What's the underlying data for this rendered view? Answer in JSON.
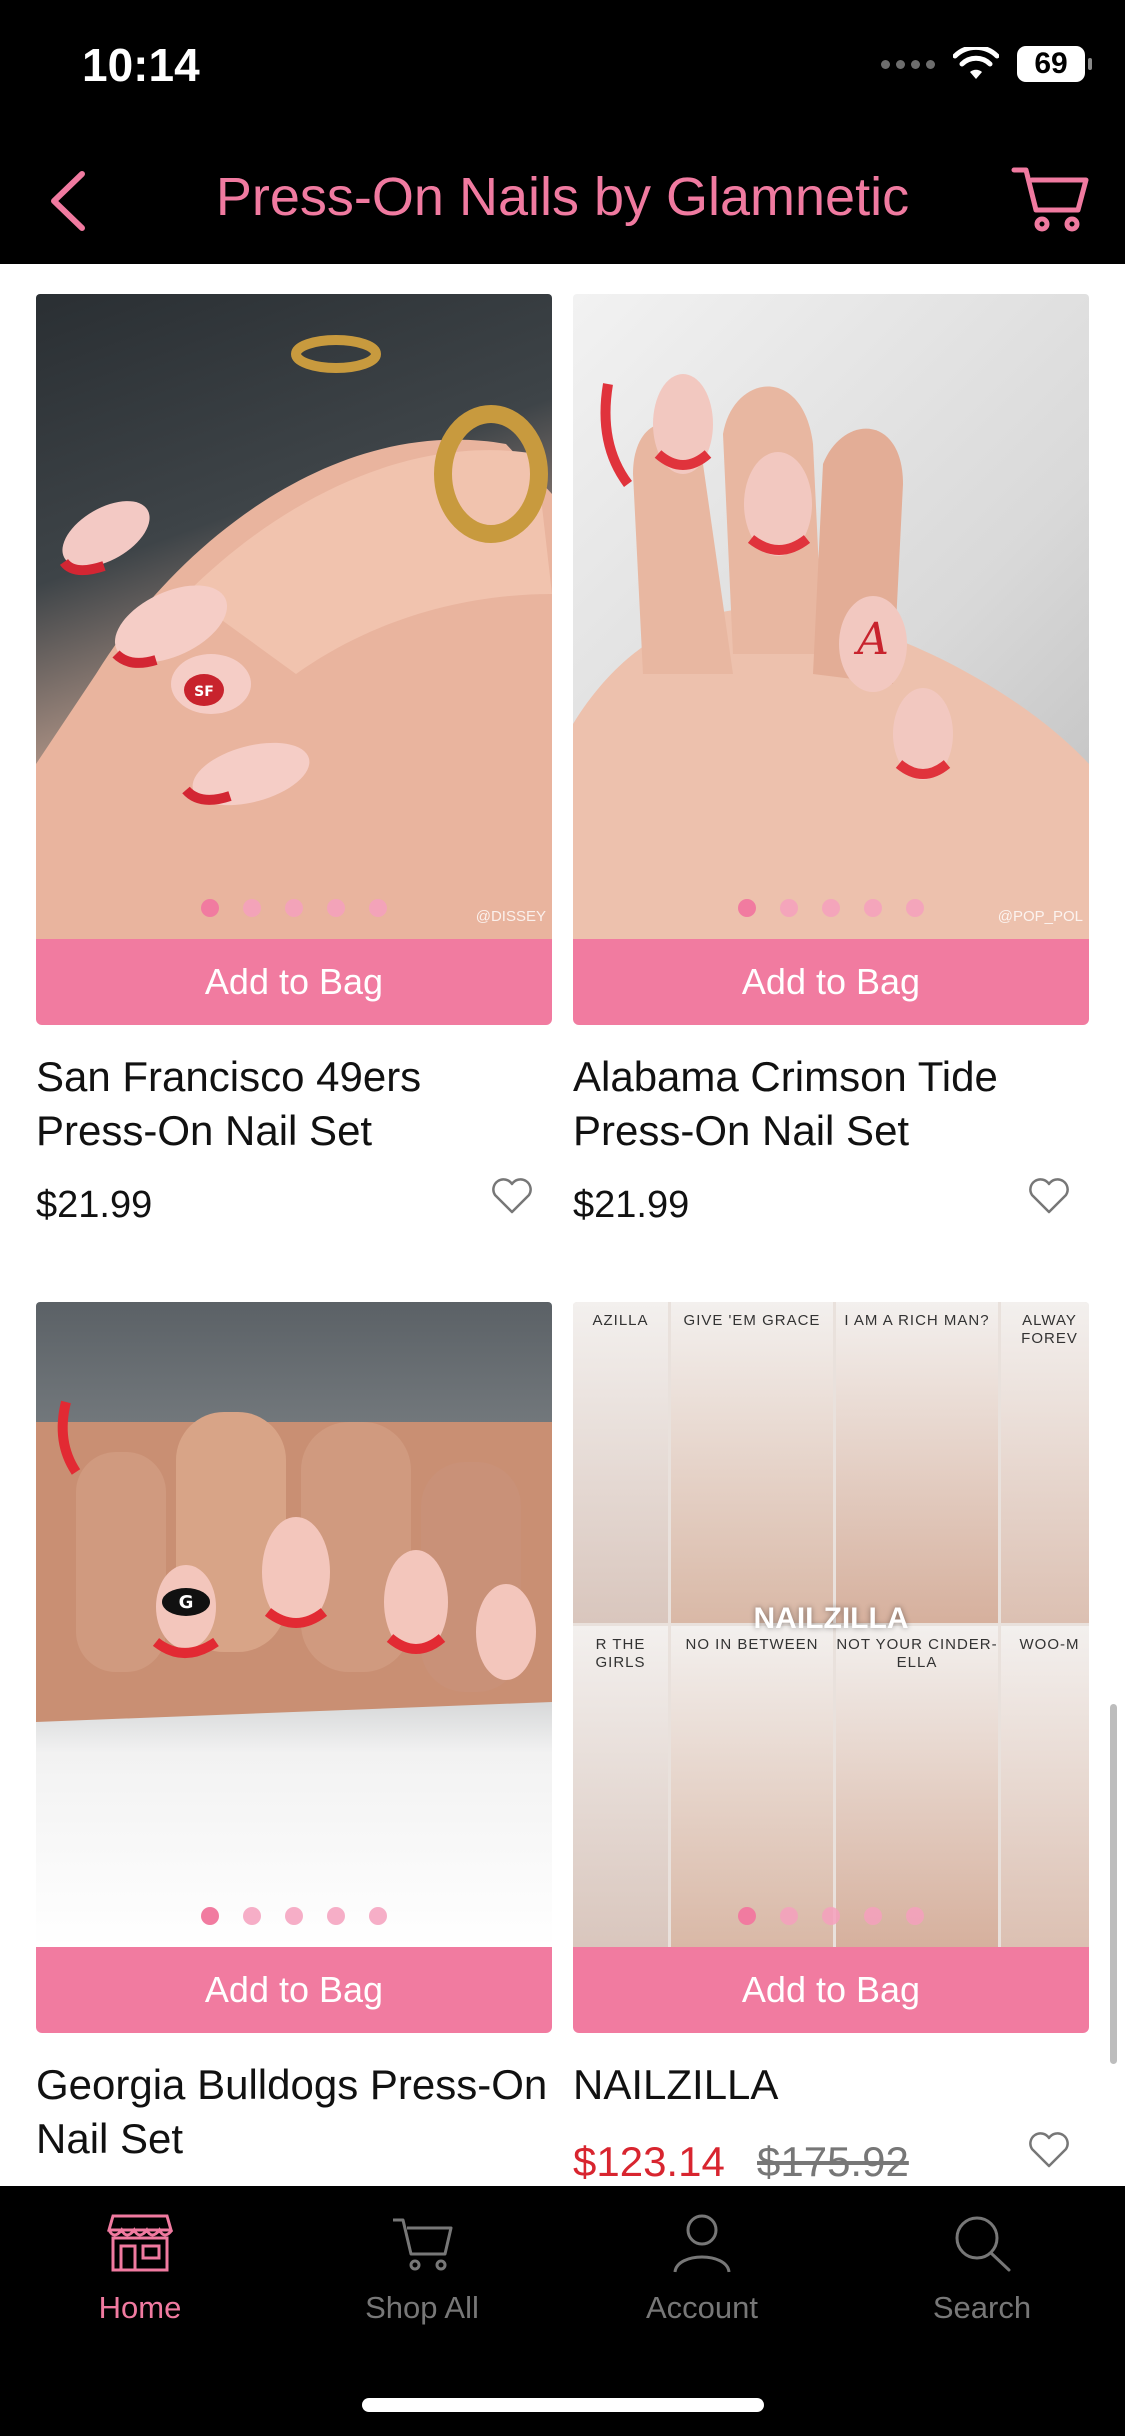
{
  "status": {
    "time": "10:14",
    "battery": "69"
  },
  "header": {
    "title": "Press-On Nails by Glamnetic"
  },
  "products": [
    {
      "title": "San Francisco 49ers Press-On Nail Set",
      "price": "$21.99",
      "button": "Add to Bag",
      "watermark": "@DISSEY"
    },
    {
      "title": "Alabama Crimson Tide Press-On Nail Set",
      "price": "$21.99",
      "button": "Add to Bag",
      "watermark": "@POP_POL"
    },
    {
      "title": "Georgia Bulldogs Press-On Nail Set",
      "price": "",
      "button": "Add to Bag",
      "watermark": ""
    },
    {
      "title": "NAILZILLA",
      "price": "$123.14",
      "original_price": "$175.92",
      "button": "Add to Bag",
      "watermark": "",
      "collage_labels": [
        "AZILLA",
        "GIVE 'EM GRACE",
        "I AM A RICH MAN?",
        "ALWAY FOREV",
        "R THE GIRLS",
        "NO IN BETWEEN",
        "NOT YOUR CINDER-ELLA",
        "WOO-M"
      ],
      "banner": "NAILZILLA"
    }
  ],
  "tabs": [
    {
      "label": "Home",
      "icon": "storefront-icon",
      "active": true
    },
    {
      "label": "Shop All",
      "icon": "cart-icon",
      "active": false
    },
    {
      "label": "Account",
      "icon": "person-icon",
      "active": false
    },
    {
      "label": "Search",
      "icon": "magnifier-icon",
      "active": false
    }
  ],
  "colors": {
    "accent": "#f17ba0",
    "sale": "#d8252f",
    "bar": "#000000"
  }
}
